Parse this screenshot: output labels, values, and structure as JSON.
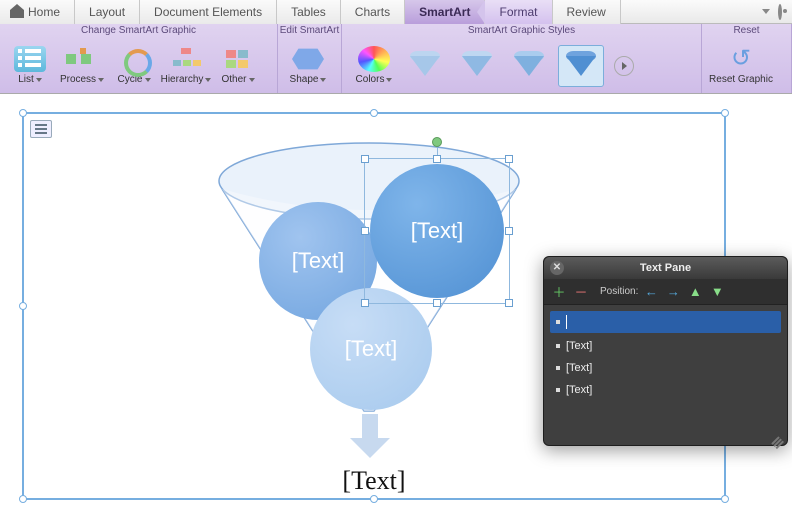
{
  "tabs": {
    "home": "Home",
    "layout": "Layout",
    "docelements": "Document Elements",
    "tables": "Tables",
    "charts": "Charts",
    "smartart": "SmartArt",
    "format": "Format",
    "review": "Review"
  },
  "ribbon": {
    "change_group": "Change SmartArt Graphic",
    "edit_group": "Edit SmartArt",
    "styles_group": "SmartArt Graphic Styles",
    "reset_group": "Reset",
    "buttons": {
      "list": "List",
      "process": "Process",
      "cycle": "Cycle",
      "hierarchy": "Hierarchy",
      "other": "Other",
      "shape": "Shape",
      "colors": "Colors",
      "reset": "Reset Graphic"
    }
  },
  "graphic": {
    "circle1": "[Text]",
    "circle2": "[Text]",
    "circle3": "[Text]",
    "result": "[Text]"
  },
  "textpane": {
    "title": "Text Pane",
    "position_label": "Position:",
    "items": [
      "",
      "[Text]",
      "[Text]",
      "[Text]"
    ]
  }
}
